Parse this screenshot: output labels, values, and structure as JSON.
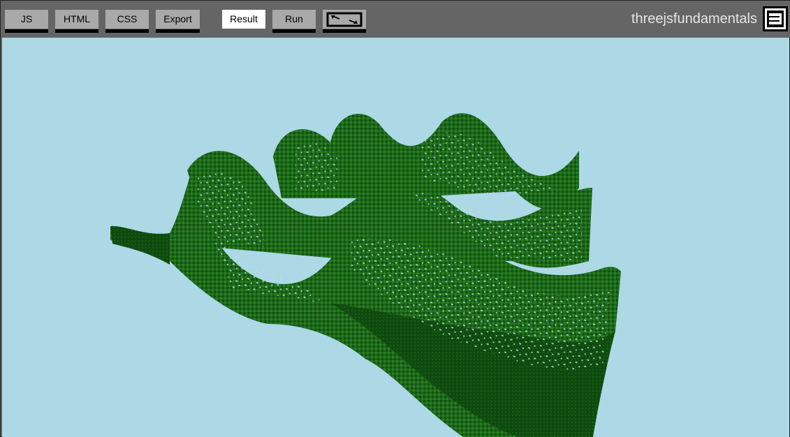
{
  "toolbar": {
    "buttons": [
      {
        "label": "JS"
      },
      {
        "label": "HTML"
      },
      {
        "label": "CSS"
      },
      {
        "label": "Export"
      },
      {
        "label": "Result"
      },
      {
        "label": "Run"
      }
    ],
    "brand": "threejsfundamentals"
  },
  "colors": {
    "toolbar_bg": "#656565",
    "button_bg": "#a9a9a9",
    "active_button_bg": "#ffffff",
    "scene_bg": "#add8e6",
    "terrain_dark": "#0d4d0d",
    "terrain_mid": "#1f6b1a",
    "terrain_light": "#2f8a2a"
  },
  "icons": {
    "fullscreen": "swap-arrows-icon",
    "logo": "threejsfundamentals-logo-icon"
  }
}
